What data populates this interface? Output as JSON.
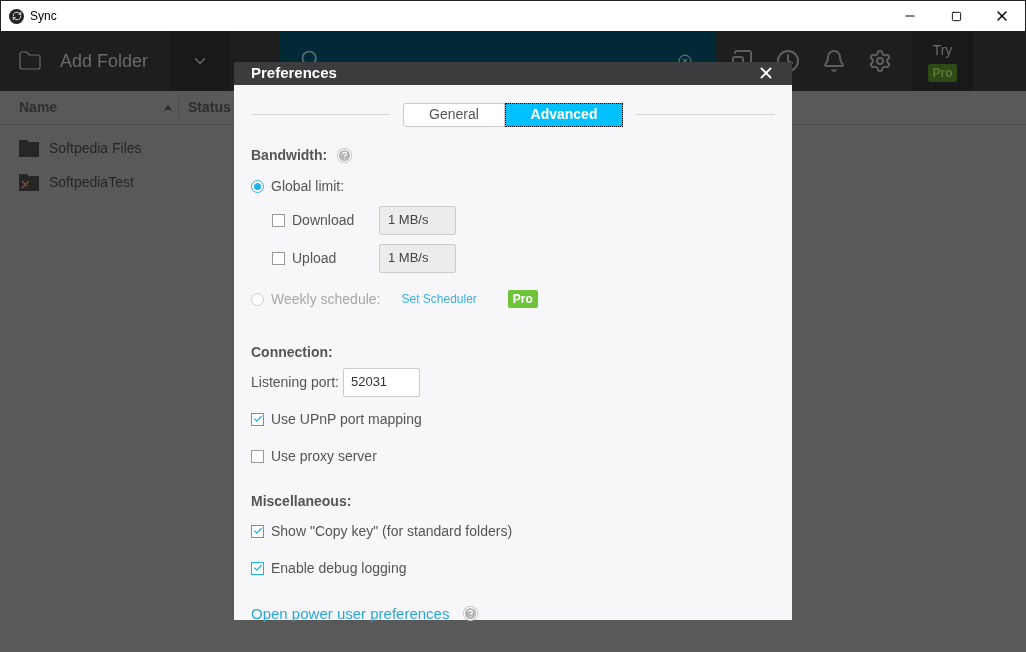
{
  "window": {
    "title": "Sync"
  },
  "toolbar": {
    "add_folder": "Add Folder",
    "try": "Try",
    "pro_badge": "Pro"
  },
  "table": {
    "columns": [
      {
        "label": "Name",
        "sorted": true
      },
      {
        "label": "Status",
        "sorted": false
      }
    ],
    "rows": [
      {
        "name": "Softpedia Files",
        "kind": "folder"
      },
      {
        "name": "SoftpediaTest",
        "kind": "broken"
      }
    ]
  },
  "dialog": {
    "title": "Preferences",
    "tabs": [
      {
        "label": "General",
        "selected": false
      },
      {
        "label": "Advanced",
        "selected": true
      }
    ],
    "bandwidth": {
      "title": "Bandwidth:",
      "options": [
        {
          "label": "Global limit:",
          "selected": true,
          "disabled": false,
          "limits": [
            {
              "label": "Download",
              "checked": false,
              "value": "1 MB/s"
            },
            {
              "label": "Upload",
              "checked": false,
              "value": "1 MB/s"
            }
          ]
        },
        {
          "label": "Weekly schedule:",
          "selected": false,
          "disabled": true,
          "link": "Set Scheduler",
          "badge": "Pro"
        }
      ]
    },
    "connection": {
      "title": "Connection:",
      "port_label": "Listening port:",
      "port_value": "52031",
      "options": [
        {
          "label": "Use UPnP port mapping",
          "checked": true
        },
        {
          "label": "Use proxy server",
          "checked": false
        }
      ]
    },
    "misc": {
      "title": "Miscellaneous:",
      "options": [
        {
          "label": "Show \"Copy key\" (for standard folders)",
          "checked": true
        },
        {
          "label": "Enable debug logging",
          "checked": true
        }
      ]
    },
    "link": "Open power user preferences"
  }
}
